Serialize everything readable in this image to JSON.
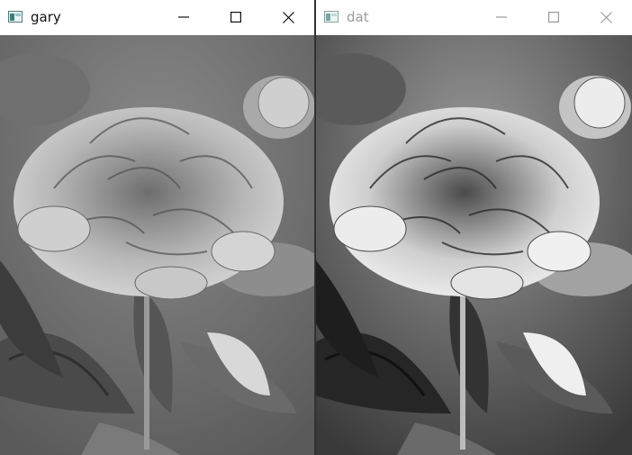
{
  "windows": [
    {
      "title": "gary",
      "active": true,
      "image_desc_icon": "peony-flower-grayscale-image",
      "tone": "gray"
    },
    {
      "title": "dat",
      "active": false,
      "image_desc_icon": "peony-flower-equalized-image",
      "tone": "contrast"
    }
  ],
  "icons": {
    "app": "opencv-window-icon",
    "minimize": "minimize-icon",
    "maximize": "maximize-icon",
    "close": "close-icon"
  },
  "colors": {
    "active_glyph": "#111111",
    "inactive_glyph": "#9a9a9a",
    "titlebar_bg": "#ffffff"
  }
}
